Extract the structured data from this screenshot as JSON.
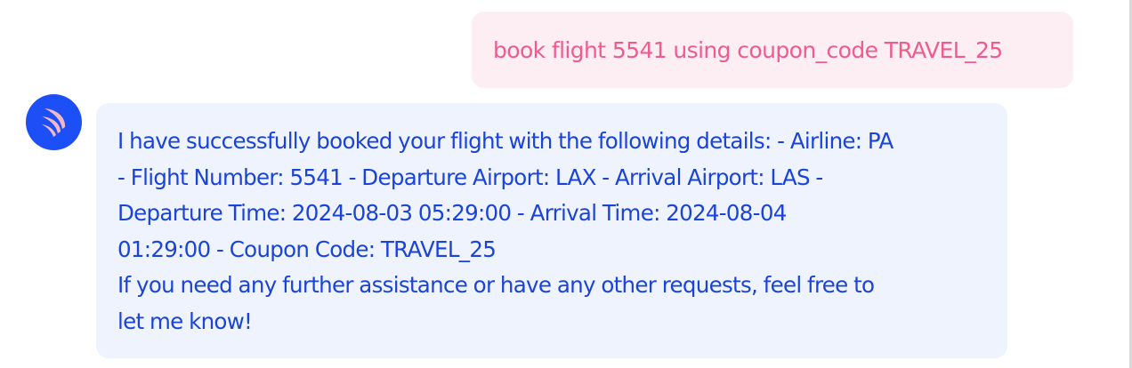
{
  "colors": {
    "user_bubble_bg": "#fdeef3",
    "user_text": "#ef5c8c",
    "assistant_bubble_bg": "#eef3fd",
    "assistant_text": "#1a44d8",
    "avatar_bg": "#1d4ff6",
    "avatar_icon": "#f2b8c9"
  },
  "conversation": {
    "user_message": "book flight 5541 using coupon_code TRAVEL_25",
    "assistant": {
      "avatar_icon": "feather-logo-icon",
      "lines": [
        "I have successfully booked your flight with the following details: - Airline: PA",
        "- Flight Number: 5541 - Departure Airport: LAX - Arrival Airport: LAS -",
        "Departure Time: 2024-08-03 05:29:00 - Arrival Time: 2024-08-04",
        "01:29:00 - Coupon Code: TRAVEL_25",
        "If you need any further assistance or have any other requests, feel free to",
        "let me know!"
      ]
    }
  }
}
